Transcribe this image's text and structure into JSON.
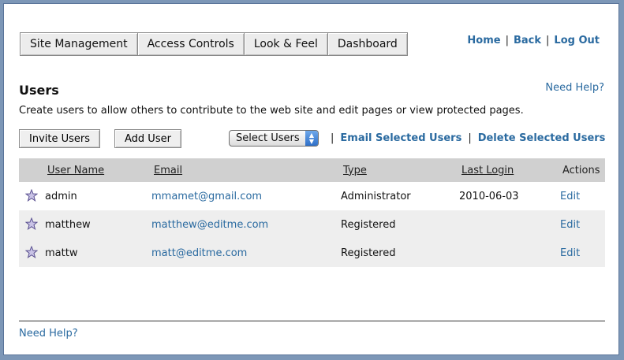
{
  "tabs": [
    {
      "label": "Site Management"
    },
    {
      "label": "Access Controls"
    },
    {
      "label": "Look & Feel"
    },
    {
      "label": "Dashboard"
    }
  ],
  "toplinks": {
    "home": "Home",
    "back": "Back",
    "logout": "Log Out",
    "separator": "|"
  },
  "help": {
    "top": "Need Help?",
    "bottom": "Need Help?"
  },
  "page": {
    "title": "Users",
    "description": "Create users to allow others to contribute to the web site and edit pages or view protected pages."
  },
  "toolbar": {
    "invite_label": "Invite Users",
    "add_label": "Add User",
    "select_value": "Select Users",
    "separator": "|",
    "email_selected": "Email Selected Users",
    "delete_selected": "Delete Selected Users"
  },
  "table": {
    "headers": {
      "username": "User Name",
      "email": "Email",
      "type": "Type",
      "last_login": "Last Login",
      "actions": "Actions"
    },
    "rows": [
      {
        "username": "admin",
        "email": "mmamet@gmail.com",
        "type": "Administrator",
        "last_login": "2010-06-03",
        "action": "Edit"
      },
      {
        "username": "matthew",
        "email": "matthew@editme.com",
        "type": "Registered",
        "last_login": "",
        "action": "Edit"
      },
      {
        "username": "mattw",
        "email": "matt@editme.com",
        "type": "Registered",
        "last_login": "",
        "action": "Edit"
      }
    ]
  },
  "colors": {
    "background": "#7d97b7",
    "link": "#2a6aa0",
    "header_row": "#d0d0d0",
    "alt_row": "#eeeeee"
  },
  "icons": {
    "row_icon": "star-icon",
    "select_arrows": "up-down-arrows-icon"
  }
}
